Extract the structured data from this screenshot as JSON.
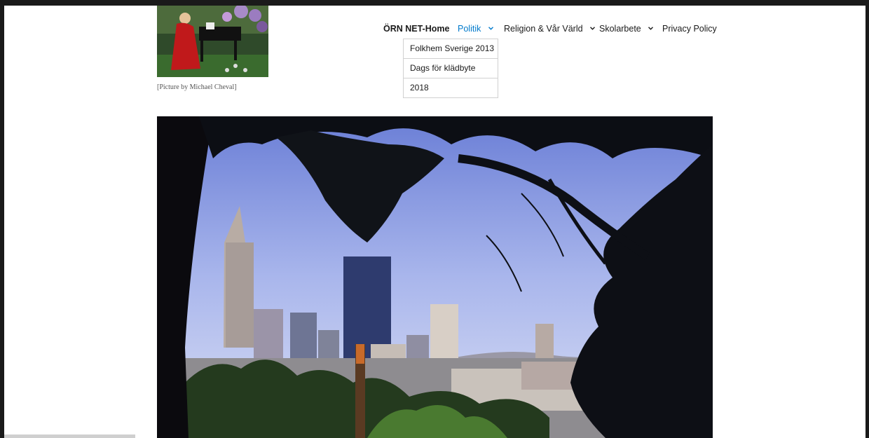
{
  "logo_caption": "[Picture by Michael Cheval]",
  "nav": {
    "items": [
      {
        "label": "ÖRN NET-Home"
      },
      {
        "label": "Politik"
      },
      {
        "label": "Religion & Vår Värld"
      },
      {
        "label": "Skolarbete"
      },
      {
        "label": "Privacy Policy"
      }
    ],
    "dropdown": [
      "Folkhem Sverige 2013",
      "Dags för klädbyte",
      "2018"
    ]
  },
  "colors": {
    "link_active": "#007acc",
    "text": "#1a1a1a",
    "border": "#d1d1d1"
  },
  "icons": [
    "chevron-down-icon"
  ]
}
